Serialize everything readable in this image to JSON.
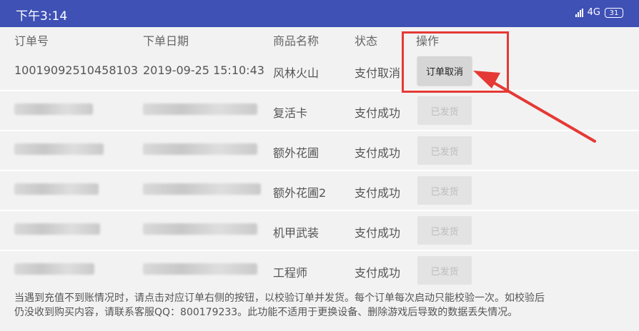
{
  "status_bar": {
    "time": "下午3:14",
    "network": "4G",
    "battery": "31",
    "bg_color": "#3f51b5"
  },
  "table": {
    "headers": [
      "订单号",
      "下单日期",
      "商品名称",
      "状态",
      "操作"
    ],
    "rows": [
      {
        "order_id": "10019092510458103",
        "date": "2019-09-25 15:10:43",
        "product": "风林火山",
        "status": "支付取消",
        "action": "订单取消",
        "action_enabled": true
      },
      {
        "order_id": "",
        "date": "",
        "product": "复活卡",
        "status": "支付成功",
        "action": "已发货",
        "action_enabled": false
      },
      {
        "order_id": "",
        "date": "",
        "product": "额外花圃",
        "status": "支付成功",
        "action": "已发货",
        "action_enabled": false
      },
      {
        "order_id": "",
        "date": "",
        "product": "额外花圃2",
        "status": "支付成功",
        "action": "已发货",
        "action_enabled": false
      },
      {
        "order_id": "",
        "date": "",
        "product": "机甲武装",
        "status": "支付成功",
        "action": "已发货",
        "action_enabled": false
      },
      {
        "order_id": "",
        "date": "",
        "product": "工程师",
        "status": "支付成功",
        "action": "已发货",
        "action_enabled": false
      }
    ]
  },
  "annotation": {
    "color": "#e53935"
  },
  "footer": {
    "line1": "当遇到充值不到账情况时，请点击对应订单右侧的按钮，以校验订单并发货。每个订单每次启动只能校验一次。如校验后",
    "line2": "仍没收到购买内容，请联系客服QQ：800179233。此功能不适用于更换设备、删除游戏后导致的数据丢失情况。"
  }
}
